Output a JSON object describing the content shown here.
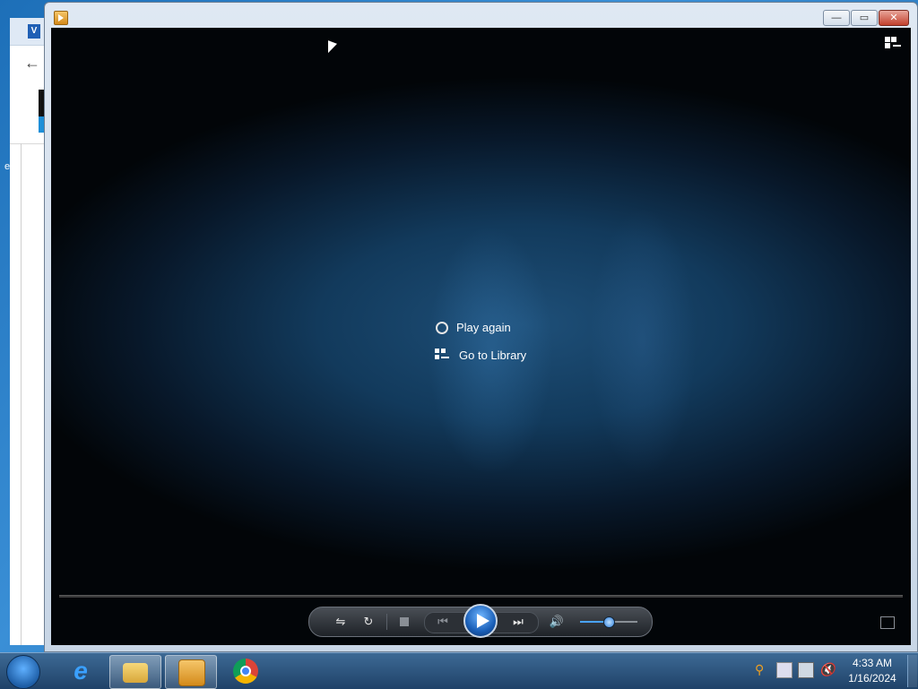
{
  "background_window": {
    "logo_letter": "V",
    "back_icon": "arrow-left-icon",
    "edge_text": "e"
  },
  "wmp": {
    "title_icon": "media-player-icon",
    "caption_buttons": {
      "minimize": "minimize-icon",
      "maximize": "maximize-icon",
      "close": "close-icon"
    },
    "switch_to_library_icon": "switch-to-library-icon",
    "end_menu": {
      "play_again": "Play again",
      "go_to_library": "Go to Library"
    },
    "controls": {
      "shuffle_icon": "shuffle-icon",
      "repeat_icon": "repeat-icon",
      "stop_icon": "stop-icon",
      "previous_icon": "previous-icon",
      "play_icon": "play-icon",
      "next_icon": "next-icon",
      "mute_icon": "speaker-icon",
      "volume_level": 0.5
    },
    "fullscreen_icon": "fullscreen-icon"
  },
  "taskbar": {
    "start_icon": "windows-start-icon",
    "apps": [
      {
        "name": "internet-explorer",
        "icon": "ie-icon",
        "active": false
      },
      {
        "name": "file-explorer",
        "icon": "folder-icon",
        "active": true
      },
      {
        "name": "windows-media-player",
        "icon": "media-player-icon",
        "active": true
      },
      {
        "name": "chrome",
        "icon": "chrome-icon",
        "active": false
      }
    ],
    "tray_icons": [
      "search-icon",
      "action-center-icon",
      "network-icon",
      "volume-muted-icon"
    ],
    "clock": {
      "time": "4:33 AM",
      "date": "1/16/2024"
    }
  }
}
